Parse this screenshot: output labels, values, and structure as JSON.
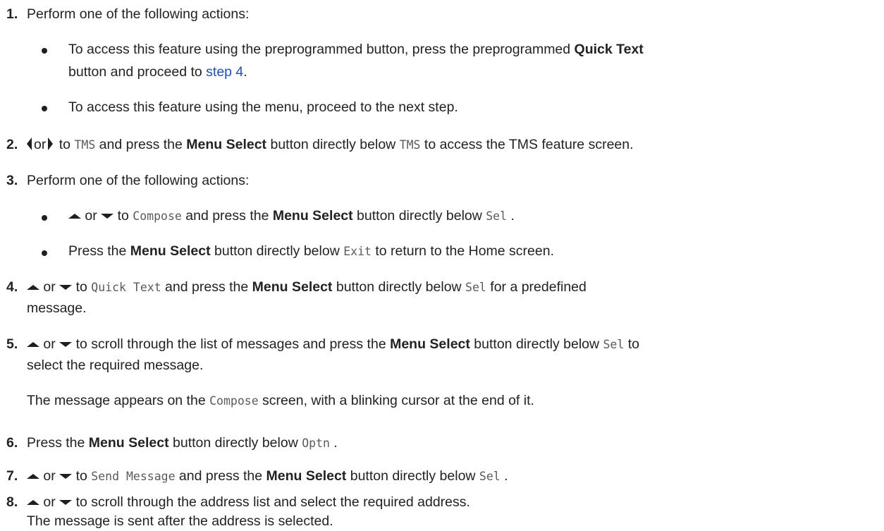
{
  "steps": {
    "s1": {
      "num": "1.",
      "text": "Perform one of the following actions:"
    },
    "s1a": {
      "t1": "To access this feature using the preprogrammed button, press the preprogrammed ",
      "b1": "Quick Text",
      "t2": "button and proceed to ",
      "link": "step 4",
      "t3": "."
    },
    "s1b": {
      "text": "To access this feature using the menu, proceed to the next step."
    },
    "s2": {
      "num": "2.",
      "or": "or",
      "t1": " to ",
      "m1": "TMS",
      "t2": " and press the ",
      "b1": "Menu Select",
      "t3": " button directly below ",
      "m2": "TMS",
      "t4": " to access the TMS feature screen."
    },
    "s3": {
      "num": "3.",
      "text": "Perform one of the following actions:"
    },
    "s3a": {
      "or": " or ",
      "t1": " to ",
      "m1": "Compose",
      "t2": " and press the ",
      "b1": "Menu Select",
      "t3": " button directly below ",
      "m2": "Sel",
      "t4": " ."
    },
    "s3b": {
      "t1": "Press the ",
      "b1": "Menu Select",
      "t2": " button directly below ",
      "m1": "Exit",
      "t3": " to return to the Home screen."
    },
    "s4": {
      "num": "4.",
      "or": " or ",
      "t1": " to ",
      "m1": "Quick Text",
      "t2": " and press the ",
      "b1": "Menu Select",
      "t3": " button directly below ",
      "m2": "Sel",
      "t4": " for a predefined",
      "t5": "message."
    },
    "s5": {
      "num": "5.",
      "or": " or ",
      "t1": " to scroll through the list of messages and press the ",
      "b1": "Menu Select",
      "t2": " button directly below ",
      "m1": "Sel",
      "t3": " to",
      "t4": "select the required message.",
      "r1": "The message appears on the ",
      "rm": "Compose",
      "r2": " screen, with a blinking cursor at the end of it."
    },
    "s6": {
      "num": "6.",
      "t1": "Press the ",
      "b1": "Menu Select",
      "t2": " button directly below ",
      "m1": "Optn",
      "t3": " ."
    },
    "s7": {
      "num": "7.",
      "or": " or ",
      "t1": " to ",
      "m1": "Send Message",
      "t2": " and press the ",
      "b1": "Menu Select",
      "t3": " button directly below ",
      "m2": "Sel",
      "t4": " ."
    },
    "s8": {
      "num": "8.",
      "or": " or ",
      "t1": " to scroll through the address list and select the required address.",
      "r1": "The message is sent after the address is selected."
    }
  },
  "icons": {
    "left": "left-triangle-icon",
    "right": "right-triangle-icon",
    "up": "up-triangle-icon",
    "down": "down-triangle-icon",
    "bullet": "bullet-icon"
  }
}
